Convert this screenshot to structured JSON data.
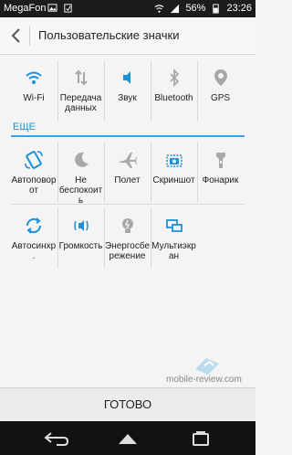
{
  "status": {
    "carrier": "MegaFon",
    "battery": "56%",
    "time": "23:26"
  },
  "header": {
    "title": "Пользовательские значки"
  },
  "rows": [
    [
      {
        "label": "Wi-Fi",
        "icon": "wifi-icon"
      },
      {
        "label": "Передача данных",
        "icon": "data-transfer-icon"
      },
      {
        "label": "Звук",
        "icon": "sound-icon"
      },
      {
        "label": "Bluetooth",
        "icon": "bluetooth-icon"
      },
      {
        "label": "GPS",
        "icon": "location-icon"
      }
    ],
    [
      {
        "label": "Автоповорот",
        "icon": "rotate-icon"
      },
      {
        "label": "Не беспокоить",
        "icon": "moon-icon"
      },
      {
        "label": "Полет",
        "icon": "airplane-icon"
      },
      {
        "label": "Скриншот",
        "icon": "screenshot-icon"
      },
      {
        "label": "Фонарик",
        "icon": "flashlight-icon"
      }
    ],
    [
      {
        "label": "Автосинхр.",
        "icon": "sync-icon"
      },
      {
        "label": "Громкость",
        "icon": "volume-icon"
      },
      {
        "label": "Энергосбережение",
        "icon": "power-saving-icon"
      },
      {
        "label": "Мультиэкран",
        "icon": "multiscreen-icon"
      }
    ]
  ],
  "section": {
    "label": "ЕЩЕ"
  },
  "footer": {
    "done_label": "ГОТОВО"
  },
  "watermark": {
    "text": "mobile-review.com"
  },
  "colors": {
    "accent": "#1e90d6",
    "active_icon": "#1e90d6",
    "inactive_icon": "#a8a8a8",
    "statusbar": "#1c1c1c",
    "navbar": "#111111"
  }
}
